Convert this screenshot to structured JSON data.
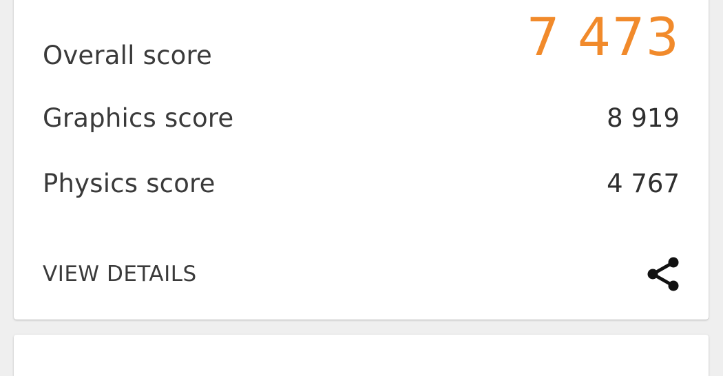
{
  "scores": {
    "overall": {
      "label": "Overall score",
      "value": "7 473"
    },
    "graphics": {
      "label": "Graphics score",
      "value": "8 919"
    },
    "physics": {
      "label": "Physics score",
      "value": "4 767"
    }
  },
  "actions": {
    "view_details_label": "VIEW DETAILS",
    "share_icon": "share-icon"
  },
  "colors": {
    "accent": "#f18a2b",
    "text": "#3a3a3a",
    "background": "#efefef",
    "card": "#ffffff"
  }
}
